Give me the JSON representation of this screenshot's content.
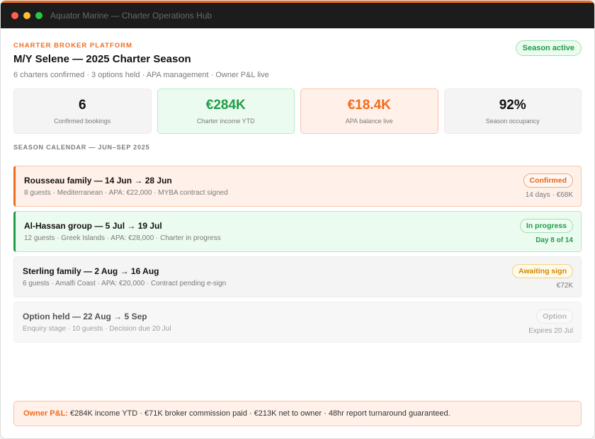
{
  "window": {
    "title": "Aquator Marine — Charter Operations Hub"
  },
  "header": {
    "eyebrow": "CHARTER BROKER PLATFORM",
    "title": "M/Y Selene — 2025 Charter Season",
    "subtitle": "6 charters confirmed · 3 options held · APA management · Owner P&L live",
    "badge": "Season active"
  },
  "kpis": [
    {
      "value": "6",
      "label": "Confirmed bookings"
    },
    {
      "value": "€284K",
      "label": "Charter income YTD"
    },
    {
      "value": "€18.4K",
      "label": "APA balance live"
    },
    {
      "value": "92%",
      "label": "Season occupancy"
    }
  ],
  "calendar": {
    "label": "SEASON CALENDAR — JUN–SEP 2025",
    "bookings": [
      {
        "title": "Rousseau family — 14 Jun → 28 Jun",
        "meta": "8 guests · Mediterranean · APA: €22,000 · MYBA contract signed",
        "status": "Confirmed",
        "right": "14 days · €68K"
      },
      {
        "title": "Al-Hassan group — 5 Jul → 19 Jul",
        "meta": "12 guests · Greek Islands · APA: €28,000 · Charter in progress",
        "status": "In progress",
        "right": "Day 8 of 14"
      },
      {
        "title": "Sterling family — 2 Aug → 16 Aug",
        "meta": "6 guests · Amalfi Coast · APA: €20,000 · Contract pending e-sign",
        "status": "Awaiting sign",
        "right": "€72K"
      },
      {
        "title": "Option held — 22 Aug → 5 Sep",
        "meta": "Enquiry stage · 10 guests · Decision due 20 Jul",
        "status": "Option",
        "right": "Expires 20 Jul"
      }
    ]
  },
  "footer": {
    "lead": "Owner P&L:",
    "text": " €284K income YTD · €71K broker commission paid · €213K net to owner · 48hr report turnaround guaranteed."
  },
  "colors": {
    "accent": "#f26b1d",
    "success": "#1f9d47",
    "warning": "#d08a06"
  }
}
